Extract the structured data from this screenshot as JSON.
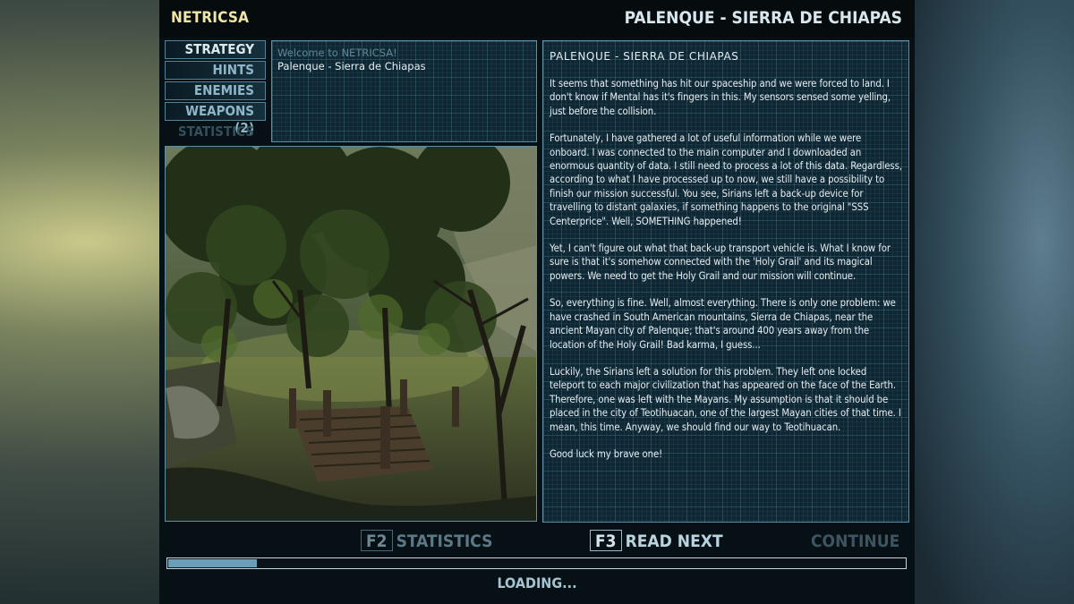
{
  "header": {
    "app_title": "NETRICSA",
    "level_title": "PALENQUE - SIERRA DE CHIAPAS"
  },
  "menu": {
    "items": [
      {
        "label": "STRATEGY",
        "state": "active"
      },
      {
        "label": "HINTS",
        "state": "normal"
      },
      {
        "label": "ENEMIES",
        "state": "normal"
      },
      {
        "label": "WEAPONS (2)",
        "state": "normal"
      },
      {
        "label": "STATISTICS",
        "state": "disabled"
      }
    ]
  },
  "messages": {
    "items": [
      {
        "label": "Welcome to NETRICSA!",
        "state": "read"
      },
      {
        "label": "Palenque - Sierra de Chiapas",
        "state": "selected"
      }
    ]
  },
  "message_view": {
    "title": "PALENQUE - SIERRA DE CHIAPAS",
    "paragraphs": [
      "It seems that something has hit our spaceship and we were forced to land. I don't know if Mental has it's fingers in this. My sensors sensed some yelling, just before the collision.",
      "Fortunately, I have gathered a lot of useful information while we were onboard. I was connected to the main computer and I downloaded an enormous quantity of data. I still need to process a lot of this data. Regardless, according to what I have processed up to now, we still have a possibility to finish our mission successful. You see, Sirians left a back-up device for travelling to distant galaxies, if something happens to the original \"SSS Centerprice\". Well, SOMETHING happened!",
      "Yet, I can't figure out what that back-up transport vehicle is.  What I know for sure is that it's somehow connected with the 'Holy Grail' and its magical powers. We need to get the Holy Grail and our mission will continue.",
      "So, everything is fine. Well, almost everything. There is only one problem: we have crashed in South American mountains, Sierra de Chiapas, near the ancient Mayan city of Palenque; that's around 400 years away from the location of the Holy Grail! Bad karma, I guess...",
      "Luckily, the Sirians left a solution for this problem. They left one locked teleport to each major civilization that has appeared on the face of the Earth. Therefore, one was left with the Mayans. My assumption is that it should be placed in the city of Teotihuacan, one of the largest Mayan cities of that time. I mean, this time. Anyway, we should find our way to Teotihuacan.",
      "Good luck my brave one!"
    ]
  },
  "footer": {
    "stats_key": "F2",
    "stats_label": "STATISTICS",
    "next_key": "F3",
    "next_label": "READ NEXT",
    "continue_label": "CONTINUE",
    "loading_label": "LOADING...",
    "loading_progress": 0.12
  },
  "colors": {
    "accent": "#efe6a8",
    "grid_border": "#5f8fa4",
    "progress_fill": "#6b9fb8"
  },
  "icons": [
    "jungle-scene-image"
  ]
}
